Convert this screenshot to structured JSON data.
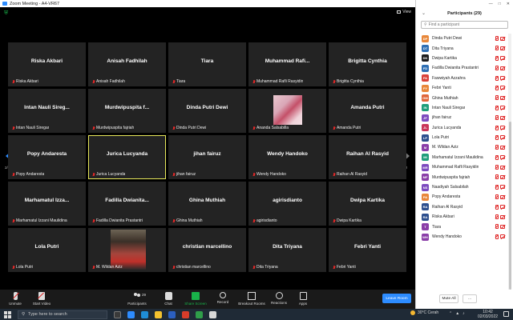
{
  "window": {
    "title": "Zoom Meeting - A4-VR67"
  },
  "meeting": {
    "view_label": "View",
    "page_indicator_left": "2/2",
    "page_indicator_right": "2/2",
    "tiles": [
      {
        "name": "Riska Akbari",
        "label": "Riska Akbari",
        "muted": true,
        "photo": false,
        "active": false
      },
      {
        "name": "Anisah Fadhilah",
        "label": "Anisah Fadhilah",
        "muted": true,
        "photo": false,
        "active": false
      },
      {
        "name": "Tiara",
        "label": "Tiara",
        "muted": true,
        "photo": false,
        "active": false
      },
      {
        "name": "Muhammad  Rafi...",
        "label": "Muhammad Rafli Rasyidin",
        "muted": true,
        "photo": false,
        "active": false
      },
      {
        "name": "Brigitta Cynthia",
        "label": "Brigitta Cynthia",
        "muted": true,
        "photo": false,
        "active": false
      },
      {
        "name": "Intan Nauli Sireg...",
        "label": "Intan Nauli Siregar",
        "muted": true,
        "photo": false,
        "active": false
      },
      {
        "name": "Murdwipuspita f...",
        "label": "Murdwipuspita fajriah",
        "muted": true,
        "photo": false,
        "active": false
      },
      {
        "name": "Dinda Putri Dewi",
        "label": "Dinda Putri Dewi",
        "muted": true,
        "photo": false,
        "active": false
      },
      {
        "name": "",
        "label": "Ananda Salsabilla",
        "muted": true,
        "photo": "ananda",
        "active": false
      },
      {
        "name": "Amanda Putri",
        "label": "Amanda Putri",
        "muted": true,
        "photo": false,
        "active": false
      },
      {
        "name": "Popy Andaresta",
        "label": "Popy Andaresta",
        "muted": true,
        "photo": false,
        "active": false
      },
      {
        "name": "Jurica Lucyanda",
        "label": "Jurica Lucyanda",
        "muted": true,
        "photo": false,
        "active": true
      },
      {
        "name": "jihan fairuz",
        "label": "jihan fairuz",
        "muted": true,
        "photo": false,
        "active": false
      },
      {
        "name": "Wendy Handoko",
        "label": "Wendy Handoko",
        "muted": true,
        "photo": false,
        "active": false
      },
      {
        "name": "Raihan Al Rasyid",
        "label": "Raihan Al Rasyid",
        "muted": true,
        "photo": false,
        "active": false
      },
      {
        "name": "Marhamatul Izza...",
        "label": "Marhamatul Izzani Maulidina",
        "muted": true,
        "photo": false,
        "active": false
      },
      {
        "name": "Fadilla Dwianita...",
        "label": "Fadilla Dwianita Prastantri",
        "muted": true,
        "photo": false,
        "active": false
      },
      {
        "name": "Ghina Muthiah",
        "label": "Ghina Muthiah",
        "muted": true,
        "photo": false,
        "active": false
      },
      {
        "name": "agirisdianto",
        "label": "agirisdianto",
        "muted": true,
        "photo": false,
        "active": false
      },
      {
        "name": "Dwipa Kartika",
        "label": "Dwipa Kartika",
        "muted": true,
        "photo": false,
        "active": false
      },
      {
        "name": "Lola Putri",
        "label": "Lola Putri",
        "muted": true,
        "photo": false,
        "active": false
      },
      {
        "name": "",
        "label": "M. Wildan Aziz",
        "muted": true,
        "photo": "wildan",
        "active": false
      },
      {
        "name": "christian marcellino",
        "label": "christian marcellino",
        "muted": true,
        "photo": false,
        "active": false
      },
      {
        "name": "Dita Triyana",
        "label": "Dita Triyana",
        "muted": true,
        "photo": false,
        "active": false
      },
      {
        "name": "Febri Yanti",
        "label": "Febri Yanti",
        "muted": true,
        "photo": false,
        "active": false
      }
    ]
  },
  "toolbar": {
    "unmute": "Unmute",
    "start_video": "Start Video",
    "participants": "Participants",
    "participants_count": "29",
    "chat": "Chat",
    "share_screen": "Share Screen",
    "record": "Record",
    "breakout_rooms": "Breakout Rooms",
    "reactions": "Reactions",
    "apps": "Apps",
    "leave_room": "Leave Room"
  },
  "panel": {
    "title": "Participants (29)",
    "search_placeholder": "Find a participant",
    "mute_all": "Mute All",
    "more": "...",
    "participants": [
      {
        "initials": "DP",
        "name": "Dinda Putri Dewi",
        "color": "#e8873a"
      },
      {
        "initials": "DT",
        "name": "Dita Triyana",
        "color": "#2f6fb3"
      },
      {
        "initials": "DK",
        "name": "Dwipa Kartika",
        "color": "#1c1c1c"
      },
      {
        "initials": "FD",
        "name": "Fadilla Dwianita Prastantri",
        "color": "#2f6fb3"
      },
      {
        "initials": "FA",
        "name": "Fawwiyah Azzahra",
        "color": "#d9423a"
      },
      {
        "initials": "FY",
        "name": "Febri Yanti",
        "color": "#e8873a"
      },
      {
        "initials": "GM",
        "name": "Ghina Muthiah",
        "color": "#e0663a"
      },
      {
        "initials": "IN",
        "name": "Intan Nauli Siregar",
        "color": "#1f9e7a"
      },
      {
        "initials": "JF",
        "name": "jihan fairuz",
        "color": "#7d4bbf"
      },
      {
        "initials": "JL",
        "name": "Jurica Lucyanda",
        "color": "#c9355a"
      },
      {
        "initials": "LP",
        "name": "Lola Putri",
        "color": "#2d4f8e"
      },
      {
        "initials": "M",
        "name": "M. Wildan Aziz",
        "color": "#8a3ea8"
      },
      {
        "initials": "MI",
        "name": "Marhamatul Izzani Maulidina",
        "color": "#1f9e7a"
      },
      {
        "initials": "MR",
        "name": "Muhammad Rafli Rasyidin",
        "color": "#7d4bbf"
      },
      {
        "initials": "MF",
        "name": "Murdwipuspita fajriah",
        "color": "#8a3ea8"
      },
      {
        "initials": "NS",
        "name": "Naadiyah Salsabilah",
        "color": "#7d4bbf"
      },
      {
        "initials": "PA",
        "name": "Popy Andaresta",
        "color": "#e8873a"
      },
      {
        "initials": "RA",
        "name": "Raihan Al Rasyid",
        "color": "#2d4f8e"
      },
      {
        "initials": "RA",
        "name": "Riska Akbari",
        "color": "#2d4f8e"
      },
      {
        "initials": "T",
        "name": "Tiara",
        "color": "#8a3ea8"
      },
      {
        "initials": "WH",
        "name": "Wendy Handoko",
        "color": "#8a3ea8"
      }
    ]
  },
  "taskbar": {
    "search_placeholder": "Type here to search",
    "weather": "30°C  Cerah",
    "time": "10:42",
    "date": "02/03/2022"
  }
}
